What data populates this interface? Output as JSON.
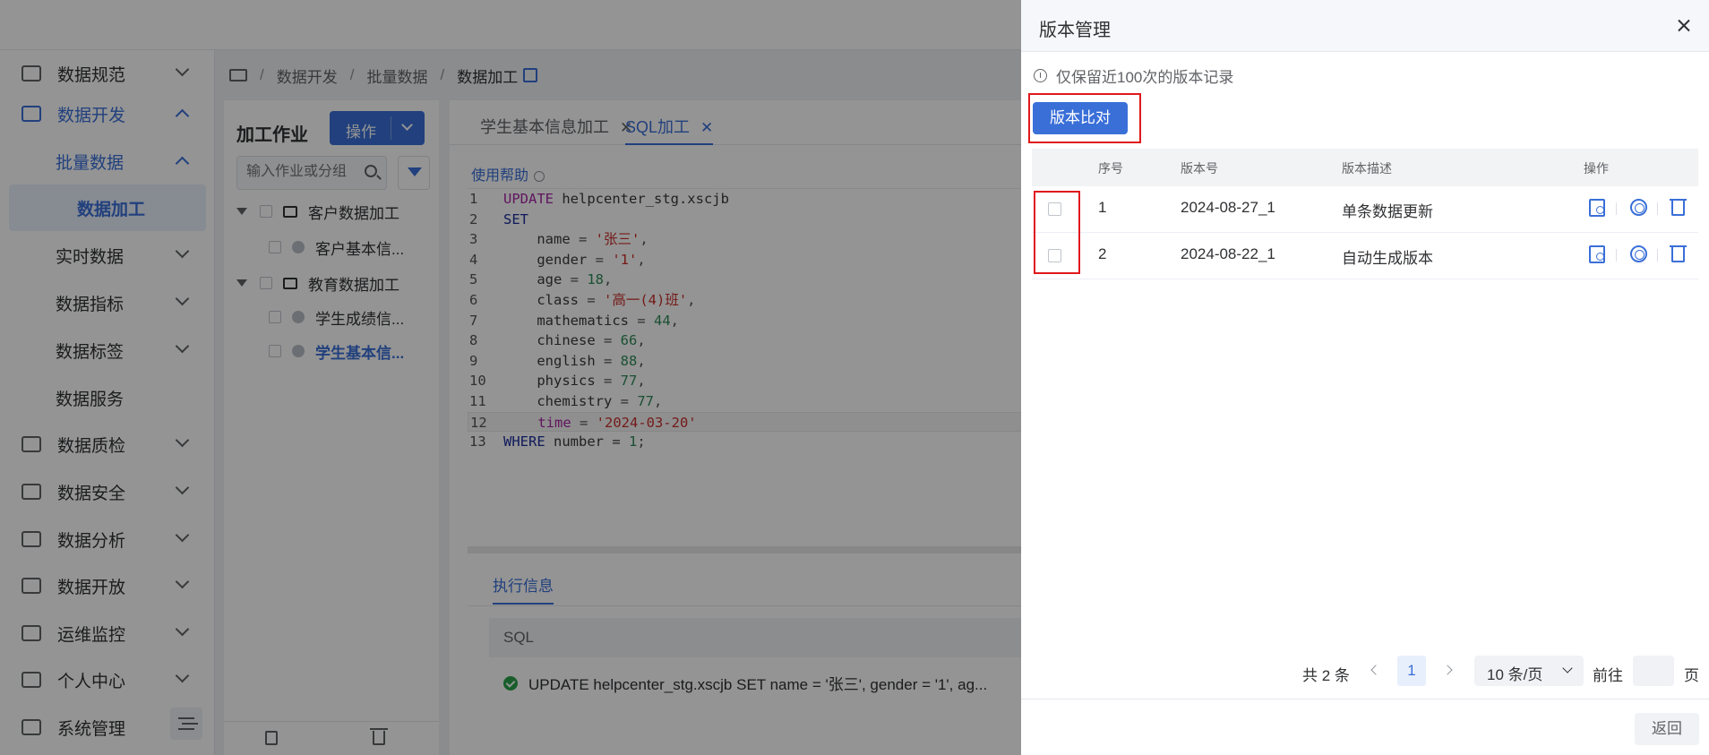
{
  "sidebar": {
    "items": [
      {
        "label": "数据规范",
        "icon": "document-icon"
      },
      {
        "label": "数据开发",
        "icon": "code-icon"
      },
      {
        "label": "批量数据"
      },
      {
        "label": "数据加工"
      },
      {
        "label": "实时数据"
      },
      {
        "label": "数据指标"
      },
      {
        "label": "数据标签"
      },
      {
        "label": "数据服务"
      },
      {
        "label": "数据质检",
        "icon": "inspect-icon"
      },
      {
        "label": "数据安全",
        "icon": "shield-icon"
      },
      {
        "label": "数据分析",
        "icon": "chart-icon"
      },
      {
        "label": "数据开放",
        "icon": "open-icon"
      },
      {
        "label": "运维监控",
        "icon": "monitor-icon"
      },
      {
        "label": "个人中心",
        "icon": "user-icon"
      },
      {
        "label": "系统管理",
        "icon": "settings-icon"
      }
    ]
  },
  "breadcrumb": {
    "items": [
      "数据开发",
      "批量数据",
      "数据加工"
    ],
    "sep": "/"
  },
  "left_panel": {
    "title": "加工作业",
    "op_button": "操作",
    "search_placeholder": "输入作业或分组",
    "tree": [
      "客户数据加工",
      "客户基本信...",
      "教育数据加工",
      "学生成绩信...",
      "学生基本信..."
    ]
  },
  "editor": {
    "tabs": [
      {
        "label": "学生基本信息加工"
      },
      {
        "label": "SQL加工"
      }
    ],
    "help": "使用帮助",
    "line_numbers": [
      "1",
      "2",
      "3",
      "4",
      "5",
      "6",
      "7",
      "8",
      "9",
      "10",
      "11",
      "12",
      "13"
    ],
    "code": {
      "l1_kw": "UPDATE",
      "l1_rest": " helpcenter_stg.xscjb",
      "l2_kw": "SET",
      "l3_var": "name",
      "l3_str": "'张三'",
      "l4_var": "gender",
      "l4_str": "'1'",
      "l5_var": "age",
      "l5_num": "18",
      "l6_var": "class",
      "l6_str": "'高一(4)班'",
      "l7_var": "mathematics",
      "l7_num": "44",
      "l8_var": "chinese",
      "l8_num": "66",
      "l9_var": "english",
      "l9_num": "88",
      "l10_var": "physics",
      "l10_num": "77",
      "l11_var": "chemistry",
      "l11_num": "77",
      "l12_var": "time",
      "l12_str": "'2024-03-20'",
      "l13_kw": "WHERE",
      "l13_rest": " number = ",
      "l13_num": "1"
    },
    "exec_tab": "执行信息",
    "exec_header": "SQL",
    "exec_row": "UPDATE helpcenter_stg.xscjb SET name = '张三', gender = '1', ag..."
  },
  "drawer": {
    "title": "版本管理",
    "notice": "仅保留近100次的版本记录",
    "compare_button": "版本比对",
    "columns": {
      "seq": "序号",
      "version": "版本号",
      "desc": "版本描述",
      "ops": "操作"
    },
    "rows": [
      {
        "seq": "1",
        "version": "2024-08-27_1",
        "desc": "单条数据更新"
      },
      {
        "seq": "2",
        "version": "2024-08-22_1",
        "desc": "自动生成版本"
      }
    ],
    "pager": {
      "total": "共 2 条",
      "page": "1",
      "size": "10 条/页",
      "goto": "前往",
      "page_suffix": "页"
    },
    "back_button": "返回"
  }
}
